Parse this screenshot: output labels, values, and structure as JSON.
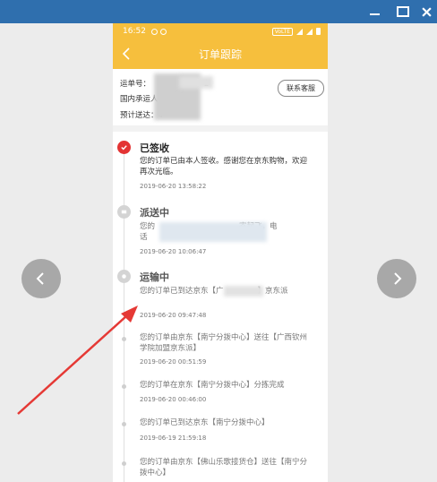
{
  "window": {
    "controls": [
      "minimize-icon",
      "maximize-icon",
      "close-icon"
    ]
  },
  "statusbar": {
    "time": "16:52",
    "volte": "VoLTE"
  },
  "nav": {
    "title": "订单跟踪"
  },
  "info": {
    "order_prefix": "运单号：",
    "order_suffix": "2",
    "carrier_prefix": "国内承运人：",
    "eta_prefix": "预计送达：",
    "eta_suffix": "4",
    "contact_label": "联系客服"
  },
  "timeline": {
    "signed": {
      "title": "已签收",
      "text": "您的订单已由本人签收。感谢您在京东购物，欢迎再次光临。",
      "time": "2019-06-20 13:58:22"
    },
    "delivering": {
      "title": "派送中",
      "text_a": "您的",
      "text_b": "寄起飞，电",
      "text_c": "话",
      "time": "2019-06-20 10:06:47"
    },
    "transit": {
      "title": "运输中",
      "text_a": "您的订单已到达京东【广",
      "text_b": "】京东派",
      "time": "2019-06-20 09:47:48"
    },
    "events": [
      {
        "text": "您的订单由京东【南宁分拨中心】送往【广西钦州学院加盟京东派】",
        "time": "2019-06-20 00:51:59"
      },
      {
        "text": "您的订单在京东【南宁分拨中心】分拣完成",
        "time": "2019-06-20 00:46:00"
      },
      {
        "text": "您的订单已到达京东【南宁分拨中心】",
        "time": "2019-06-19 21:59:18"
      },
      {
        "text": "您的订单由京东【佛山乐歌接货仓】送往【南宁分拨中心】",
        "time": ""
      }
    ]
  },
  "colors": {
    "accent": "#f6bf3d",
    "signed_red": "#e33333",
    "titlebar": "#2f6fae",
    "annotation_arrow": "#e53935"
  }
}
